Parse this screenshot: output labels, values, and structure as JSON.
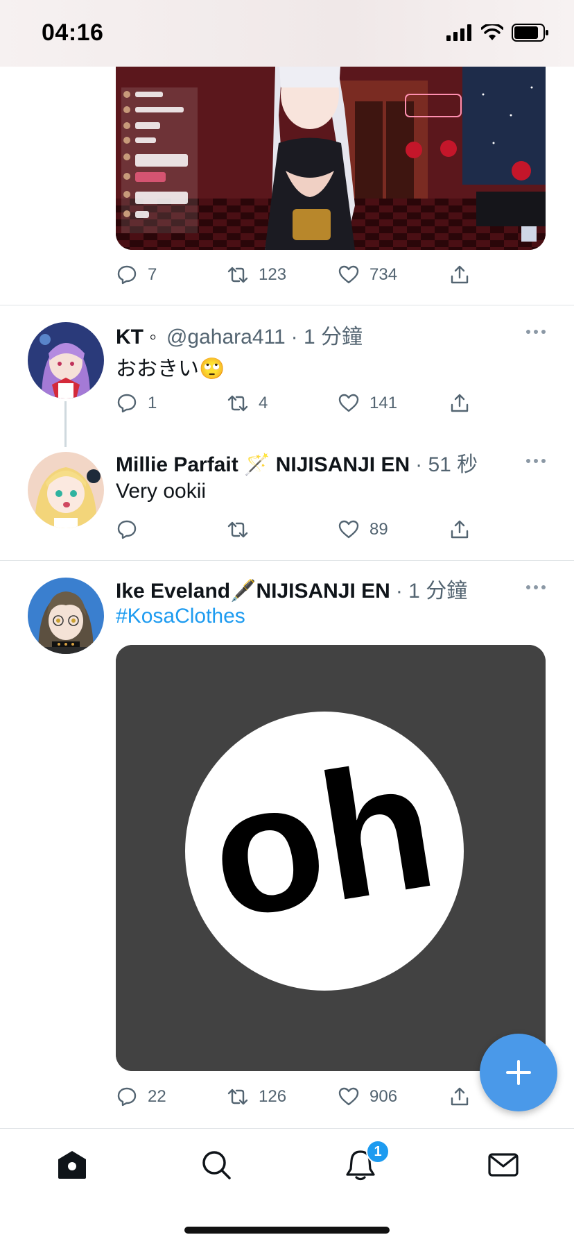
{
  "status_bar": {
    "time": "04:16"
  },
  "tweets": [
    {
      "actions": {
        "replies": "7",
        "retweets": "123",
        "likes": "734"
      }
    },
    {
      "name": "KT ◦",
      "handle": "@gahara411",
      "time": "· 1 分鐘",
      "text": "おおきい🙄",
      "actions": {
        "replies": "1",
        "retweets": "4",
        "likes": "141"
      }
    },
    {
      "name": "Millie Parfait 🪄 NIJISANJI EN",
      "time": "· 51 秒",
      "text": "Very ookii",
      "actions": {
        "replies": "",
        "retweets": "",
        "likes": "89"
      }
    },
    {
      "name": "Ike Eveland🖋️NIJISANJI EN",
      "time": "· 1 分鐘",
      "text": "#KosaClothes",
      "media_text": "oh",
      "actions": {
        "replies": "22",
        "retweets": "126",
        "likes": "906"
      }
    }
  ],
  "tab_bar": {
    "items": [
      "home-icon",
      "search-icon",
      "notifications-icon",
      "messages-icon"
    ],
    "notification_count": "1"
  },
  "colors": {
    "accent": "#1d9bf0",
    "fab": "#4a99e9",
    "meta": "#536471"
  }
}
